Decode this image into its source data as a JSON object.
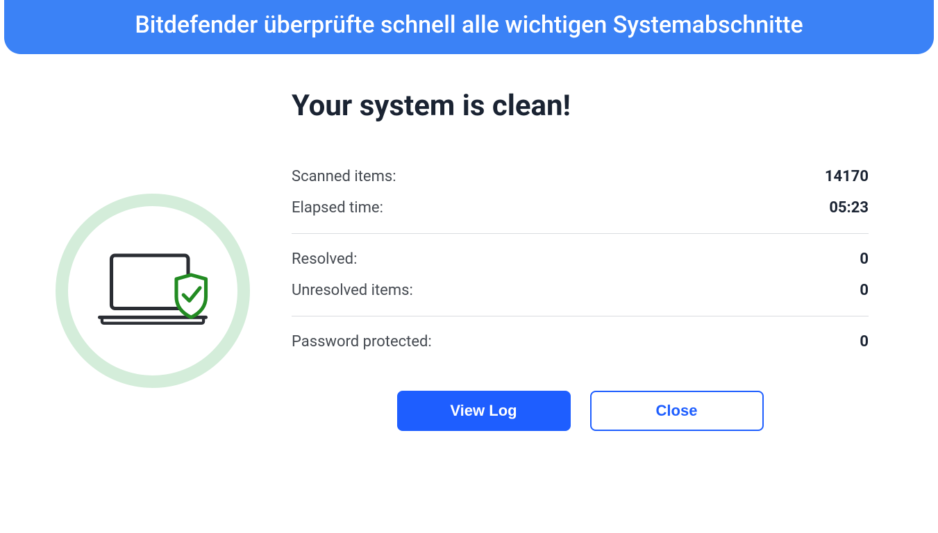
{
  "banner": {
    "text": "Bitdefender überprüfte schnell alle wichtigen Systemabschnitte"
  },
  "result": {
    "title": "Your system is clean!",
    "stats": {
      "scanned_label": "Scanned items:",
      "scanned_value": "14170",
      "elapsed_label": "Elapsed time:",
      "elapsed_value": "05:23",
      "resolved_label": "Resolved:",
      "resolved_value": "0",
      "unresolved_label": "Unresolved items:",
      "unresolved_value": "0",
      "password_label": "Password protected:",
      "password_value": "0"
    }
  },
  "buttons": {
    "view_log": "View Log",
    "close": "Close"
  },
  "colors": {
    "banner_bg": "#3b82f6",
    "primary_btn": "#1e5eff",
    "circle_border": "#d4edda",
    "shield_green": "#228B22"
  }
}
